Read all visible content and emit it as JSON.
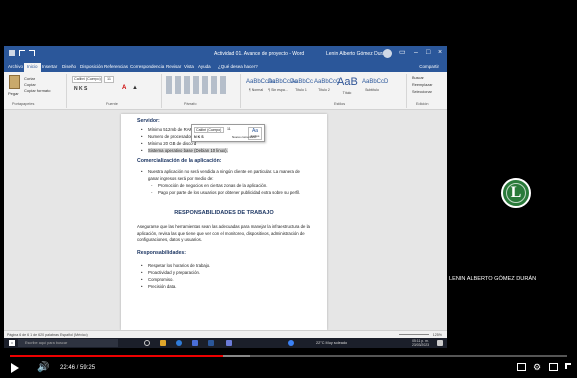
{
  "word": {
    "title": "Actividad 01. Avance de proyecto - Word",
    "user": "Lenin Alberto Gómez Durán",
    "tabs": [
      "Archivo",
      "Inicio",
      "Insertar",
      "Diseño",
      "Disposición",
      "Referencias",
      "Correspondencia",
      "Revisar",
      "Vista",
      "Ayuda",
      "¿Qué desea hacer?"
    ],
    "share": "Compartir",
    "ribbon": {
      "paste": "Pegar",
      "cut": "Cortar",
      "copy": "Copiar",
      "format_painter": "Copiar formato",
      "clipboard": "Portapapeles",
      "font_group": "Fuente",
      "paragraph_group": "Párrafo",
      "styles_group": "Estilos",
      "editing_group": "Edición",
      "font_name": "Calibri (Cuerpo)",
      "font_size": "11",
      "format_buttons": "N K S",
      "styles": [
        {
          "sample": "AaBbCcDc",
          "name": "¶ Normal"
        },
        {
          "sample": "AaBbCcDc",
          "name": "¶ Sin espa..."
        },
        {
          "sample": "AaBbCc",
          "name": "Título 1"
        },
        {
          "sample": "AaBbCcC",
          "name": "Título 2"
        },
        {
          "sample": "AaB",
          "name": "Título"
        },
        {
          "sample": "AaBbCcD",
          "name": "Subtítulo"
        }
      ],
      "find": "Buscar",
      "replace": "Reemplazar",
      "select": "Seleccionar"
    },
    "document": {
      "servidor_heading": "Servidor:",
      "servidor_items": [
        "Mínimo 512mb de RAM.",
        "Numero de procesadores",
        "Mínimo 20 GB de disco d",
        "Sistema operativo base (Debian 10 linux)."
      ],
      "comercializacion_heading": "Comercialización de la aplicación:",
      "comercializacion_text_1": "Nuestra aplicación no será vendida a ningún cliente en particular. La manera de",
      "comercializacion_text_2": "ganar ingresos será por medio de:",
      "comercializacion_sub": [
        "Promoción de negocios en ciertas zonas de la aplicación.",
        "Pago por parte de los usuarios por obtener publicidad extra sobre su perfil."
      ],
      "responsabilidades_title": "RESPONSABILIDADES DE TRABAJO",
      "responsabilidades_para": "Asegurarse que las herramientas sean las adecuadas para manejar la infraestructura de la aplicación, revisa las que tiene que ver con el monitoreo, dispositivos, administración de configuraciones, datos y usuarios.",
      "resp_heading": "Responsabilidades:",
      "resp_items": [
        "Respetar los horarios de trabajo.",
        "Proactividad y preparación.",
        "Compromiso.",
        "Precisión data."
      ]
    },
    "mini_toolbar": {
      "font": "Calibri (Cuerpo)",
      "size": "11",
      "row": "N K S",
      "styles": "Estilos",
      "new_comment": "Nuevo comentario"
    },
    "status": {
      "page_info": "Página 6 de 6   1 de 620 palabras   Español (México)",
      "zoom": "125%"
    }
  },
  "taskbar": {
    "search_placeholder": "Escribe aquí para buscar",
    "weather": "22°C  Muy soleado",
    "time": "05:11 p. m.",
    "date": "23/03/2023"
  },
  "participant": {
    "initial": "L",
    "name": "LENIN ALBERTO GÓMEZ DURÁN",
    "avatar_color": "#2a7a3a"
  },
  "video": {
    "current_time": "22:46 / 59:25",
    "progress": 0.383,
    "buffered": 0.43,
    "accent": "#ee0000"
  }
}
